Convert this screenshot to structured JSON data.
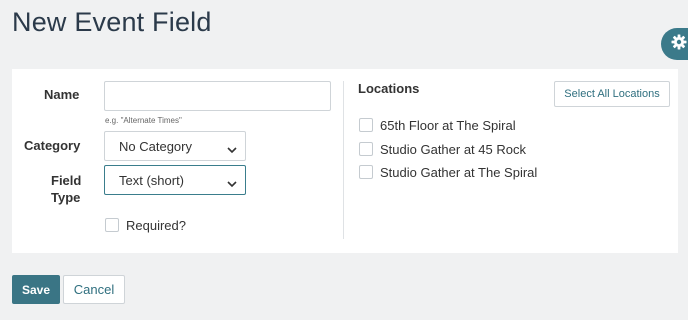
{
  "page": {
    "title": "New Event Field"
  },
  "form": {
    "name_label": "Name",
    "name_value": "",
    "name_hint": "e.g. \"Alternate Times\"",
    "category_label": "Category",
    "category_value": "No Category",
    "field_type_label_line1": "Field",
    "field_type_label_line2": "Type",
    "field_type_value": "Text (short)",
    "required_label": "Required?",
    "required_checked": false
  },
  "locations": {
    "title": "Locations",
    "select_all_label": "Select All Locations",
    "items": [
      {
        "label": "65th Floor at The Spiral",
        "checked": false
      },
      {
        "label": "Studio Gather at 45 Rock",
        "checked": false
      },
      {
        "label": "Studio Gather at The Spiral",
        "checked": false
      }
    ]
  },
  "actions": {
    "save_label": "Save",
    "cancel_label": "Cancel"
  },
  "icons": {
    "settings": "gear-icon",
    "dropdown": "chevron-down-icon"
  },
  "colors": {
    "accent": "#3a7585",
    "title": "#2b3a4a",
    "link": "#2f6f7f",
    "background": "#f0f1f2"
  }
}
